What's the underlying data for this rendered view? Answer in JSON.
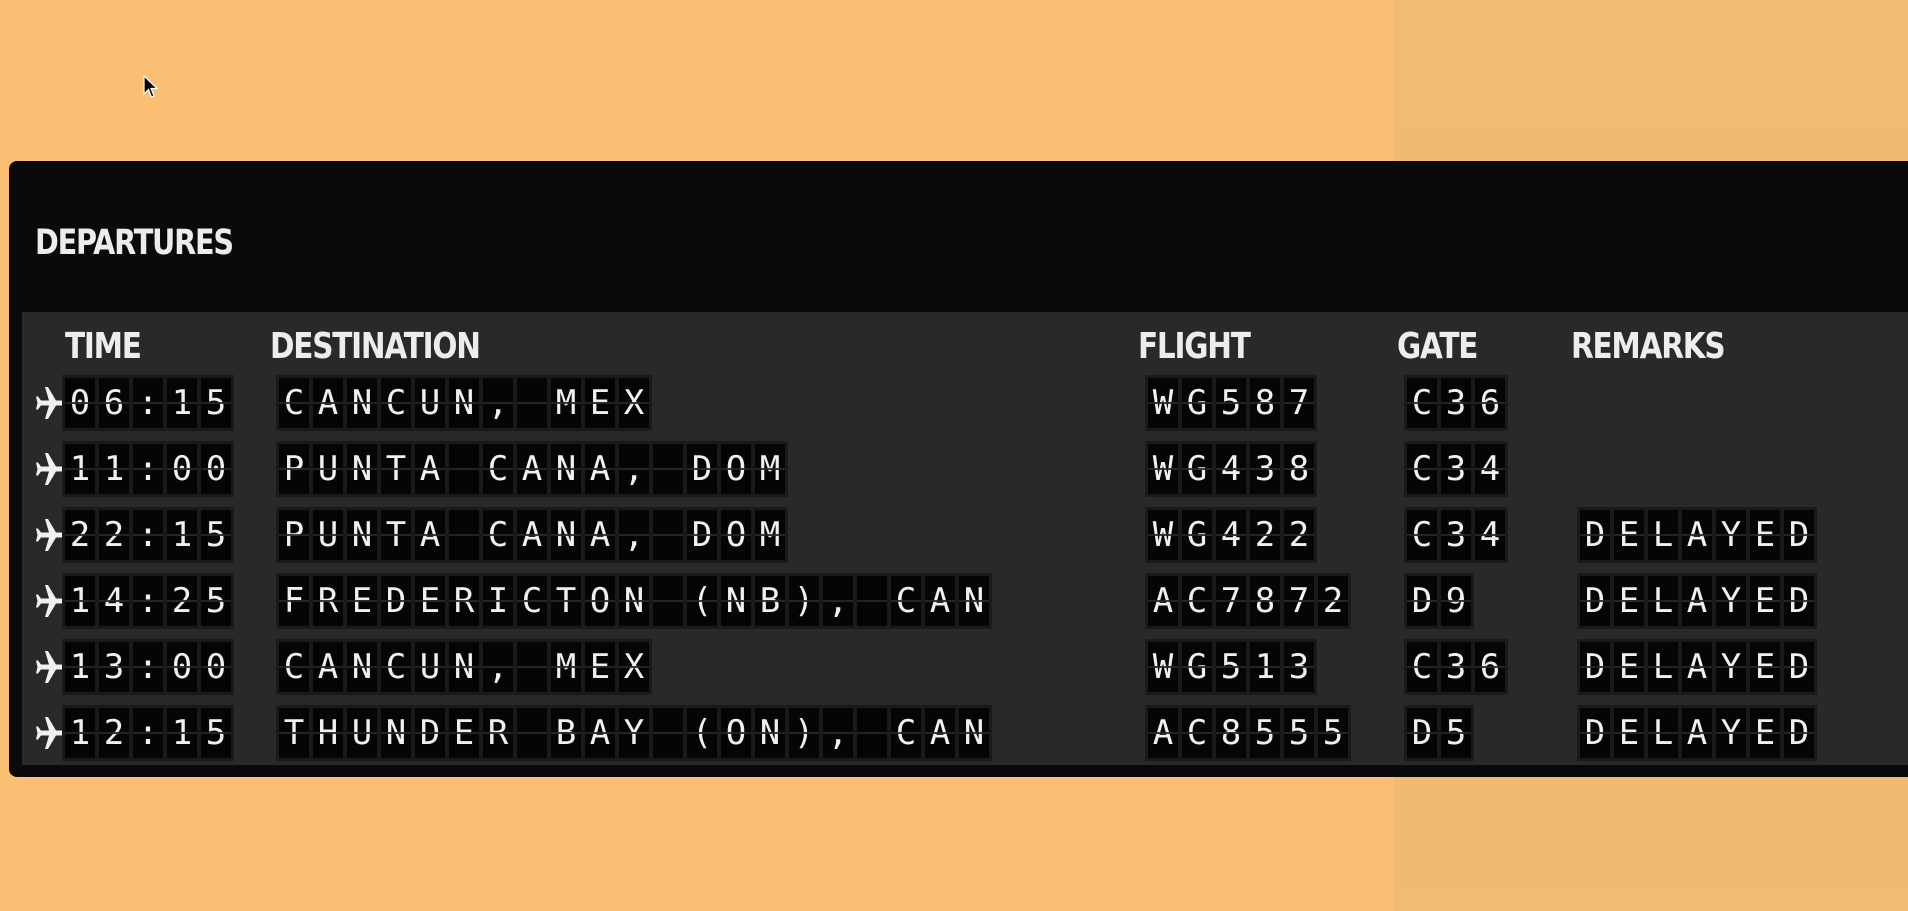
{
  "board": {
    "title": "DEPARTURES",
    "headers": {
      "time": "TIME",
      "destination": "DESTINATION",
      "flight": "FLIGHT",
      "gate": "GATE",
      "remarks": "REMARKS"
    },
    "flights": [
      {
        "time": "06:15",
        "destination": "CANCUN, MEX",
        "flight": "WG587",
        "gate": "C36",
        "remarks": ""
      },
      {
        "time": "11:00",
        "destination": "PUNTA CANA, DOM",
        "flight": "WG438",
        "gate": "C34",
        "remarks": ""
      },
      {
        "time": "22:15",
        "destination": "PUNTA CANA, DOM",
        "flight": "WG422",
        "gate": "C34",
        "remarks": "DELAYED"
      },
      {
        "time": "14:25",
        "destination": "FREDERICTON (NB), CAN",
        "flight": "AC7872",
        "gate": "D9",
        "remarks": "DELAYED"
      },
      {
        "time": "13:00",
        "destination": "CANCUN, MEX",
        "flight": "WG513",
        "gate": "C36",
        "remarks": "DELAYED"
      },
      {
        "time": "12:15",
        "destination": "THUNDER BAY (ON), CAN",
        "flight": "AC8555",
        "gate": "D5",
        "remarks": "DELAYED"
      }
    ]
  },
  "icons": {
    "row_icon": "airplane-icon",
    "pointer": "mouse-cursor-icon"
  },
  "colors": {
    "page_background": "#fbbf74",
    "board_background": "#0a0a0d",
    "panel_background": "#29292b",
    "text": "#f0f0f0"
  }
}
